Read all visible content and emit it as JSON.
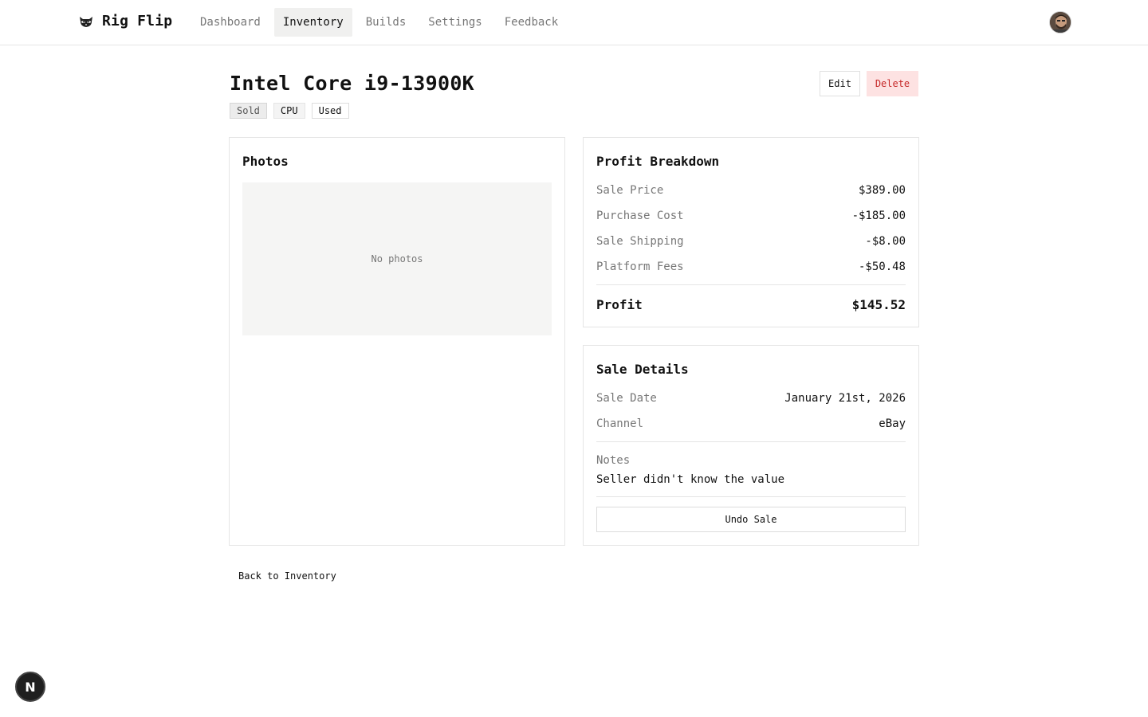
{
  "app": {
    "name": "Rig Flip",
    "logo_icon": "raccoon-icon"
  },
  "nav": {
    "items": [
      {
        "label": "Dashboard",
        "active": false
      },
      {
        "label": "Inventory",
        "active": true
      },
      {
        "label": "Builds",
        "active": false
      },
      {
        "label": "Settings",
        "active": false
      },
      {
        "label": "Feedback",
        "active": false
      }
    ]
  },
  "item": {
    "title": "Intel Core i9-13900K",
    "tags": [
      "Sold",
      "CPU",
      "Used"
    ]
  },
  "actions": {
    "edit_label": "Edit",
    "delete_label": "Delete"
  },
  "photos": {
    "title": "Photos",
    "empty_text": "No photos"
  },
  "profit": {
    "title": "Profit Breakdown",
    "rows": [
      {
        "label": "Sale Price",
        "value": "$389.00"
      },
      {
        "label": "Purchase Cost",
        "value": "-$185.00"
      },
      {
        "label": "Sale Shipping",
        "value": "-$8.00"
      },
      {
        "label": "Platform Fees",
        "value": "-$50.48"
      }
    ],
    "total": {
      "label": "Profit",
      "value": "$145.52"
    }
  },
  "sale": {
    "title": "Sale Details",
    "rows": [
      {
        "label": "Sale Date",
        "value": "January 21st, 2026"
      },
      {
        "label": "Channel",
        "value": "eBay"
      }
    ],
    "notes_label": "Notes",
    "notes_text": "Seller didn't know the value",
    "undo_label": "Undo Sale"
  },
  "back_link": "Back to Inventory",
  "dev_badge": "N",
  "colors": {
    "delete_bg": "#fde2e2",
    "delete_text": "#c62828",
    "active_nav_bg": "#f0f0ef"
  }
}
